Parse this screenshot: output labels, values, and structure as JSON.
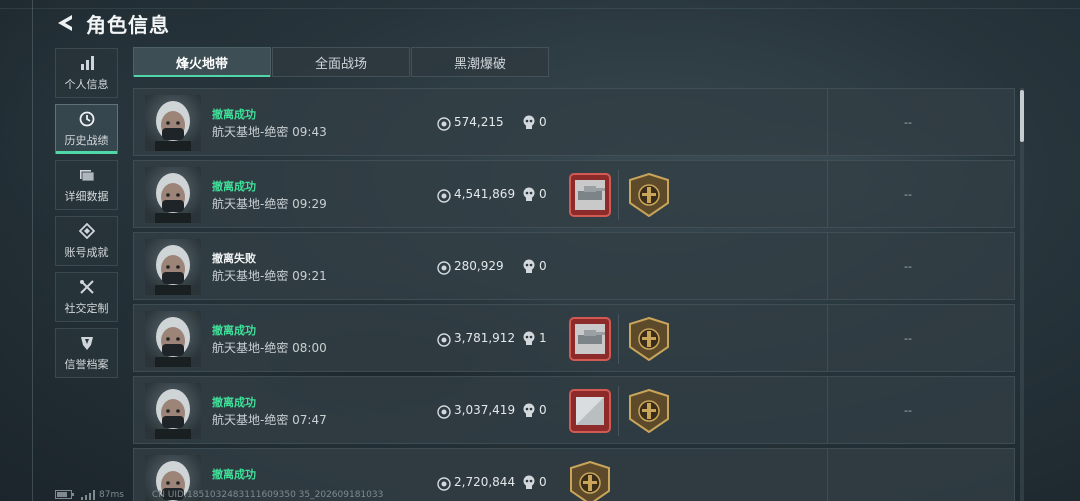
{
  "header": {
    "title": "角色信息"
  },
  "sidebar": {
    "items": [
      {
        "label": "个人信息",
        "icon": "bar-chart-icon"
      },
      {
        "label": "历史战绩",
        "icon": "clock-icon",
        "active": true
      },
      {
        "label": "详细数据",
        "icon": "folder-icon"
      },
      {
        "label": "账号成就",
        "icon": "achievement-icon"
      },
      {
        "label": "社交定制",
        "icon": "tools-icon"
      },
      {
        "label": "信誉档案",
        "icon": "shield-icon"
      }
    ]
  },
  "tabs": [
    {
      "label": "烽火地带",
      "active": true
    },
    {
      "label": "全面战场"
    },
    {
      "label": "黑潮爆破"
    }
  ],
  "matches": [
    {
      "status": "撤离成功",
      "result": "success",
      "map_time": "航天基地-绝密 09:43",
      "value": "574,215",
      "kills": "0",
      "badges": [],
      "extra": "--"
    },
    {
      "status": "撤离成功",
      "result": "success",
      "map_time": "航天基地-绝密 09:29",
      "value": "4,541,869",
      "kills": "0",
      "badges": [
        "red-tank-badge-icon",
        "gold-emblem-badge-icon"
      ],
      "extra": "--"
    },
    {
      "status": "撤离失败",
      "result": "fail",
      "map_time": "航天基地-绝密 09:21",
      "value": "280,929",
      "kills": "0",
      "badges": [],
      "extra": "--"
    },
    {
      "status": "撤离成功",
      "result": "success",
      "map_time": "航天基地-绝密 08:00",
      "value": "3,781,912",
      "kills": "1",
      "badges": [
        "red-tank-badge-icon",
        "gold-emblem-badge-icon"
      ],
      "extra": "--"
    },
    {
      "status": "撤离成功",
      "result": "success",
      "map_time": "航天基地-绝密 07:47",
      "value": "3,037,419",
      "kills": "0",
      "badges": [
        "red-plate-badge-icon",
        "gold-emblem-badge-icon"
      ],
      "extra": "--"
    },
    {
      "status": "撤离成功",
      "result": "success",
      "map_time": "",
      "value": "2,720,844",
      "kills": "0",
      "badges": [
        "gold-emblem-badge-icon"
      ],
      "extra": ""
    }
  ],
  "footer": {
    "ping": "87ms",
    "uid": "CN UID:1851032483111609350 35_202609181033"
  },
  "colors": {
    "accent": "#4fd7a8",
    "success": "#3fe09a",
    "fail": "#f0f2f3",
    "badge_red": "#b83a3a",
    "badge_gold": "#b8964a"
  }
}
